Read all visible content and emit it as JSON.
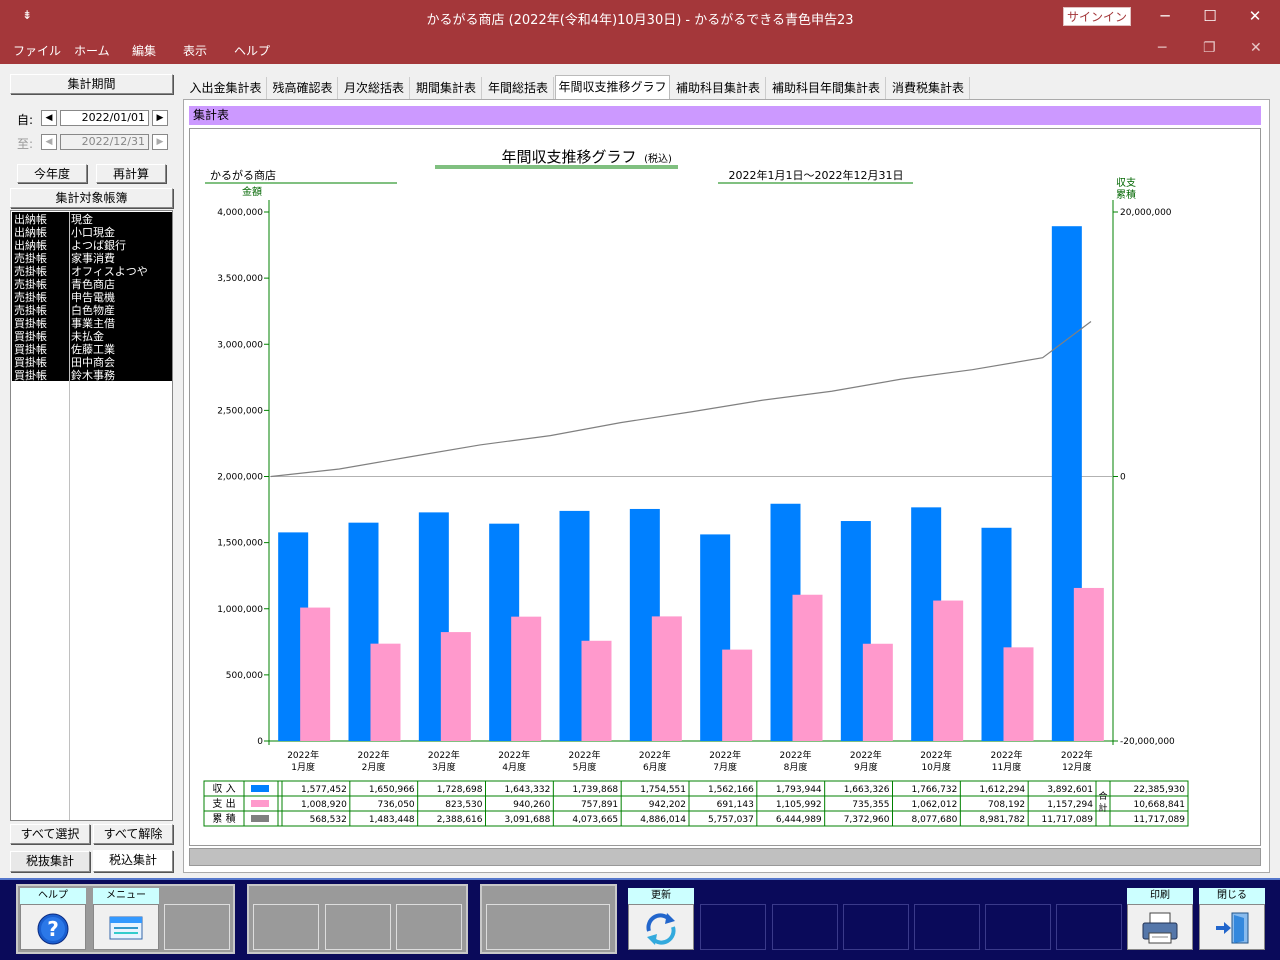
{
  "window": {
    "title": "かるがる商店 (2022年(令和4年)10月30日)  -  かるがるできる青色申告23",
    "signin": "サインイン",
    "sysbtn": "⇟"
  },
  "menu": [
    "ファイル",
    "ホーム",
    "編集",
    "表示",
    "ヘルプ"
  ],
  "left": {
    "period_header": "集計期間",
    "from_label": "自:",
    "to_label": "至:",
    "from_date": "2022/01/01",
    "to_date": "2022/12/31",
    "this_year": "今年度",
    "recalc": "再計算",
    "ledger_header": "集計対象帳簿",
    "ledgers": [
      {
        "type": "出納帳",
        "name": "現金"
      },
      {
        "type": "出納帳",
        "name": "小口現金"
      },
      {
        "type": "出納帳",
        "name": "よつば銀行"
      },
      {
        "type": "売掛帳",
        "name": "家事消費"
      },
      {
        "type": "売掛帳",
        "name": "オフィスよつや"
      },
      {
        "type": "売掛帳",
        "name": "青色商店"
      },
      {
        "type": "売掛帳",
        "name": "申告電機"
      },
      {
        "type": "売掛帳",
        "name": "白色物産"
      },
      {
        "type": "買掛帳",
        "name": "事業主借"
      },
      {
        "type": "買掛帳",
        "name": "未払金"
      },
      {
        "type": "買掛帳",
        "name": "佐藤工業"
      },
      {
        "type": "買掛帳",
        "name": "田中商会"
      },
      {
        "type": "買掛帳",
        "name": "鈴木事務"
      }
    ],
    "select_all": "すべて選択",
    "deselect_all": "すべて解除",
    "tax_excl": "税抜集計",
    "tax_incl": "税込集計"
  },
  "tabs": [
    "入出金集計表",
    "残高確認表",
    "月次総括表",
    "期間集計表",
    "年間総括表",
    "年間収支推移グラフ",
    "補助科目集計表",
    "補助科目年間集計表",
    "消費税集計表"
  ],
  "section_title": "集計表",
  "chart_data": {
    "type": "bar",
    "title": "年間収支推移グラフ",
    "title_note": "(税込)",
    "shop": "かるがる商店",
    "period": "2022年1月1日～2022年12月31日",
    "ylabel": "金額",
    "y2label_1": "収支",
    "y2label_2": "累積",
    "ylim": [
      0,
      4000000
    ],
    "y2lim": [
      -20000000,
      20000000
    ],
    "yticks": [
      "0",
      "500,000",
      "1,000,000",
      "1,500,000",
      "2,000,000",
      "2,500,000",
      "3,000,000",
      "3,500,000",
      "4,000,000"
    ],
    "y2ticks": [
      "-20,000,000",
      "0",
      "20,000,000"
    ],
    "categories": [
      [
        "2022年",
        "1月度"
      ],
      [
        "2022年",
        "2月度"
      ],
      [
        "2022年",
        "3月度"
      ],
      [
        "2022年",
        "4月度"
      ],
      [
        "2022年",
        "5月度"
      ],
      [
        "2022年",
        "6月度"
      ],
      [
        "2022年",
        "7月度"
      ],
      [
        "2022年",
        "8月度"
      ],
      [
        "2022年",
        "9月度"
      ],
      [
        "2022年",
        "10月度"
      ],
      [
        "2022年",
        "11月度"
      ],
      [
        "2022年",
        "12月度"
      ]
    ],
    "series": [
      {
        "name": "収 入",
        "color": "#0080ff",
        "axis": "left",
        "values": [
          1577452,
          1650966,
          1728698,
          1643332,
          1739868,
          1754551,
          1562166,
          1793944,
          1663326,
          1766732,
          1612294,
          3892601
        ],
        "display": [
          "1,577,452",
          "1,650,966",
          "1,728,698",
          "1,643,332",
          "1,739,868",
          "1,754,551",
          "1,562,166",
          "1,793,944",
          "1,663,326",
          "1,766,732",
          "1,612,294",
          "3,892,601"
        ],
        "total": "22,385,930"
      },
      {
        "name": "支 出",
        "color": "#ff99cc",
        "axis": "left",
        "values": [
          1008920,
          736050,
          823530,
          940260,
          757891,
          942202,
          691143,
          1105992,
          735355,
          1062012,
          708192,
          1157294
        ],
        "display": [
          "1,008,920",
          "736,050",
          "823,530",
          "940,260",
          "757,891",
          "942,202",
          "691,143",
          "1,105,992",
          "735,355",
          "1,062,012",
          "708,192",
          "1,157,294"
        ],
        "total": "10,668,841"
      },
      {
        "name": "累 積",
        "color": "#808080",
        "axis": "right",
        "values": [
          568532,
          1483448,
          2388616,
          3091688,
          4073665,
          4886014,
          5757037,
          6444989,
          7372960,
          8077680,
          8981782,
          11717089
        ],
        "display": [
          "568,532",
          "1,483,448",
          "2,388,616",
          "3,091,688",
          "4,073,665",
          "4,886,014",
          "5,757,037",
          "6,444,989",
          "7,372,960",
          "8,077,680",
          "8,981,782",
          "11,717,089"
        ],
        "total": "11,717,089"
      }
    ],
    "total_label_1": "合",
    "total_label_2": "計"
  },
  "fkeys": {
    "help": "ヘルプ",
    "menu": "メニュー",
    "refresh": "更新",
    "print": "印刷",
    "close": "閉じる"
  }
}
